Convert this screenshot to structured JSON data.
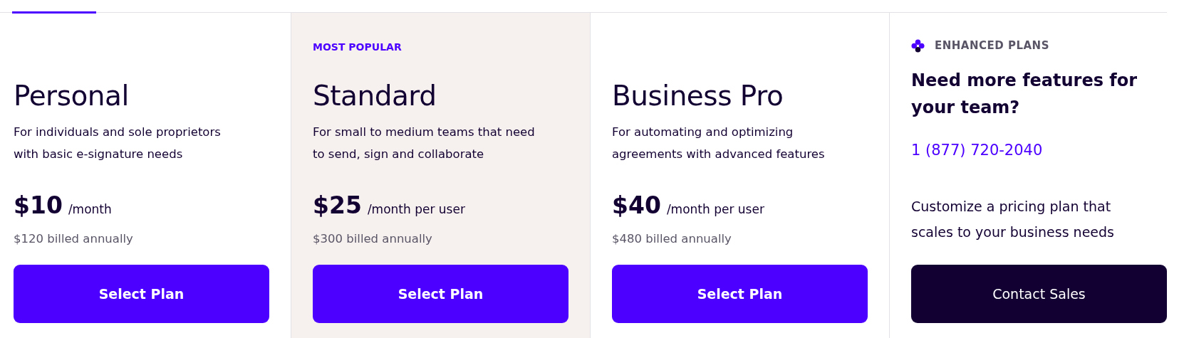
{
  "plans": [
    {
      "kind": "plan",
      "highlighted": false,
      "name": "Personal",
      "description": "For individuals and sole proprietors with basic e-signature needs",
      "price": "$10",
      "period": "/month",
      "annual": "$120 billed annually",
      "button": "Select Plan"
    },
    {
      "kind": "plan",
      "highlighted": true,
      "badge": "MOST POPULAR",
      "name": "Standard",
      "description": "For small to medium teams that need to send, sign and collaborate",
      "price": "$25",
      "period": "/month per user",
      "annual": "$300 billed annually",
      "button": "Select Plan"
    },
    {
      "kind": "plan",
      "highlighted": false,
      "name": "Business Pro",
      "description": "For automating and optimizing agreements with advanced features",
      "price": "$40",
      "period": "/month per user",
      "annual": "$480 billed annually",
      "button": "Select Plan"
    },
    {
      "kind": "contact",
      "highlighted": false,
      "eyebrow": "ENHANCED PLANS",
      "name": "Need more features for your team?",
      "phone": "1 (877) 720-2040",
      "description": "Customize a pricing plan that scales to your business needs",
      "button": "Contact Sales"
    }
  ]
}
